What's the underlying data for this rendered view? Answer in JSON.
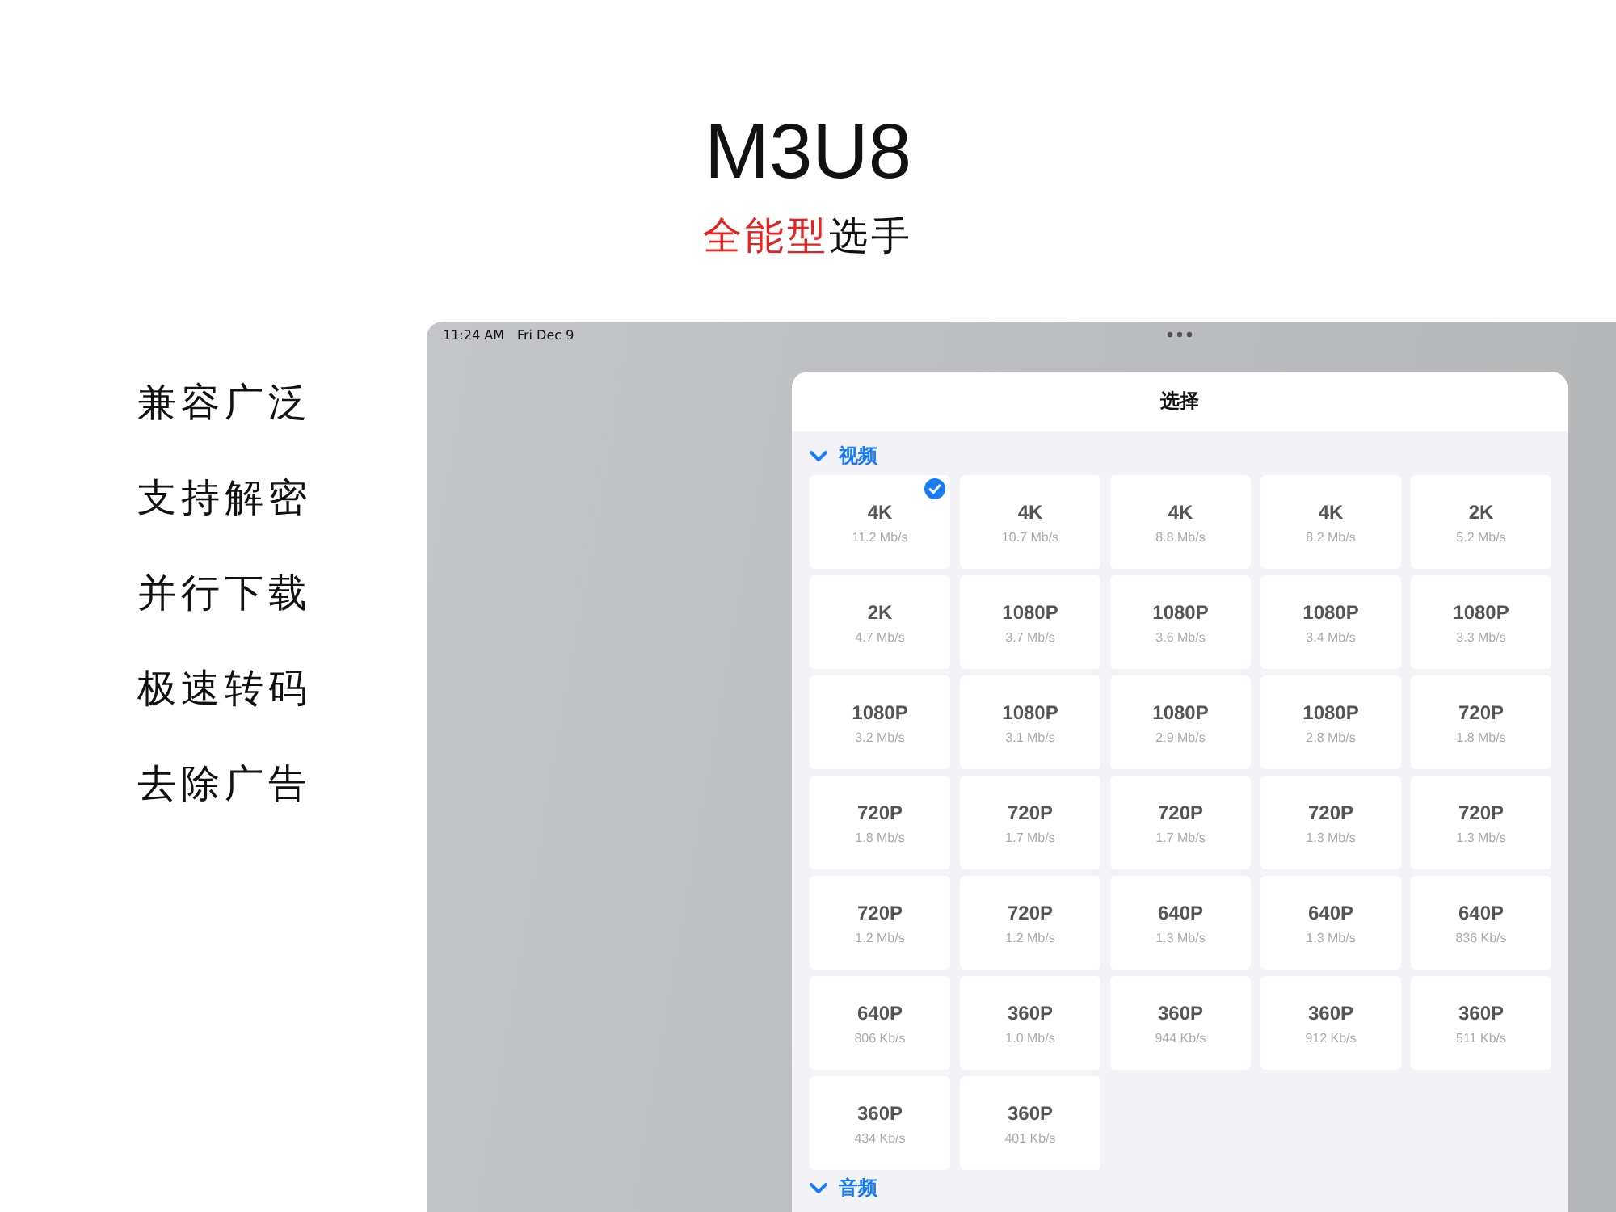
{
  "title": "M3U8",
  "subtitle": [
    {
      "text": "全能型",
      "highlight": true
    },
    {
      "text": "选手",
      "highlight": false
    }
  ],
  "features": [
    "兼容广泛",
    "支持解密",
    "并行下载",
    "极速转码",
    "去除广告"
  ],
  "device": {
    "status_bar": {
      "time": "11:24 AM",
      "date": "Fri Dec 9"
    },
    "sheet": {
      "title": "选择",
      "sections": [
        {
          "title": "视频",
          "expanded": true,
          "options": [
            {
              "resolution": "4K",
              "bitrate": "11.2 Mb/s",
              "selected": true
            },
            {
              "resolution": "4K",
              "bitrate": "10.7 Mb/s",
              "selected": false
            },
            {
              "resolution": "4K",
              "bitrate": "8.8 Mb/s",
              "selected": false
            },
            {
              "resolution": "4K",
              "bitrate": "8.2 Mb/s",
              "selected": false
            },
            {
              "resolution": "2K",
              "bitrate": "5.2 Mb/s",
              "selected": false
            },
            {
              "resolution": "2K",
              "bitrate": "4.7 Mb/s",
              "selected": false
            },
            {
              "resolution": "1080P",
              "bitrate": "3.7 Mb/s",
              "selected": false
            },
            {
              "resolution": "1080P",
              "bitrate": "3.6 Mb/s",
              "selected": false
            },
            {
              "resolution": "1080P",
              "bitrate": "3.4 Mb/s",
              "selected": false
            },
            {
              "resolution": "1080P",
              "bitrate": "3.3 Mb/s",
              "selected": false
            },
            {
              "resolution": "1080P",
              "bitrate": "3.2 Mb/s",
              "selected": false
            },
            {
              "resolution": "1080P",
              "bitrate": "3.1 Mb/s",
              "selected": false
            },
            {
              "resolution": "1080P",
              "bitrate": "2.9 Mb/s",
              "selected": false
            },
            {
              "resolution": "1080P",
              "bitrate": "2.8 Mb/s",
              "selected": false
            },
            {
              "resolution": "720P",
              "bitrate": "1.8 Mb/s",
              "selected": false
            },
            {
              "resolution": "720P",
              "bitrate": "1.8 Mb/s",
              "selected": false
            },
            {
              "resolution": "720P",
              "bitrate": "1.7 Mb/s",
              "selected": false
            },
            {
              "resolution": "720P",
              "bitrate": "1.7 Mb/s",
              "selected": false
            },
            {
              "resolution": "720P",
              "bitrate": "1.3 Mb/s",
              "selected": false
            },
            {
              "resolution": "720P",
              "bitrate": "1.3 Mb/s",
              "selected": false
            },
            {
              "resolution": "720P",
              "bitrate": "1.2 Mb/s",
              "selected": false
            },
            {
              "resolution": "720P",
              "bitrate": "1.2 Mb/s",
              "selected": false
            },
            {
              "resolution": "640P",
              "bitrate": "1.3 Mb/s",
              "selected": false
            },
            {
              "resolution": "640P",
              "bitrate": "1.3 Mb/s",
              "selected": false
            },
            {
              "resolution": "640P",
              "bitrate": "836 Kb/s",
              "selected": false
            },
            {
              "resolution": "640P",
              "bitrate": "806 Kb/s",
              "selected": false
            },
            {
              "resolution": "360P",
              "bitrate": "1.0 Mb/s",
              "selected": false
            },
            {
              "resolution": "360P",
              "bitrate": "944 Kb/s",
              "selected": false
            },
            {
              "resolution": "360P",
              "bitrate": "912 Kb/s",
              "selected": false
            },
            {
              "resolution": "360P",
              "bitrate": "511 Kb/s",
              "selected": false
            },
            {
              "resolution": "360P",
              "bitrate": "434 Kb/s",
              "selected": false
            },
            {
              "resolution": "360P",
              "bitrate": "401 Kb/s",
              "selected": false
            }
          ]
        },
        {
          "title": "音频",
          "expanded": true
        }
      ]
    }
  }
}
